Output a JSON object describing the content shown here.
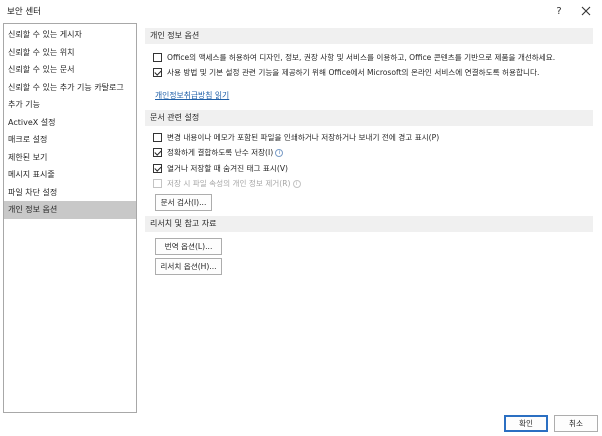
{
  "window": {
    "title": "보안 센터",
    "help": "?",
    "close": "✕"
  },
  "sidebar": {
    "items": [
      {
        "label": "신뢰할 수 있는 게시자"
      },
      {
        "label": "신뢰할 수 있는 위치"
      },
      {
        "label": "신뢰할 수 있는 문서"
      },
      {
        "label": "신뢰할 수 있는 추가 기능 카탈로그"
      },
      {
        "label": "추가 기능"
      },
      {
        "label": "ActiveX 설정"
      },
      {
        "label": "매크로 설정"
      },
      {
        "label": "제한된 보기"
      },
      {
        "label": "메시지 표시줄"
      },
      {
        "label": "파일 차단 설정"
      },
      {
        "label": "개인 정보 옵션"
      }
    ]
  },
  "privacy": {
    "header": "개인 정보 옵션",
    "opt1": {
      "label": "Office의 액세스를 허용하여 디자인, 정보, 권장 사항 및 서비스를 이용하고, Office 콘텐츠를 기반으로 제품을 개선하세요.",
      "checked": false
    },
    "opt2": {
      "label": "사용 방법 및 기본 설정 관련 기능을 제공하기 위해 Office에서 Microsoft의 온라인 서비스에 연결하도록 허용합니다.",
      "checked": true
    },
    "link": "개인정보취급방침 읽기"
  },
  "document": {
    "header": "문서 관련 설정",
    "opt1": {
      "label": "변경 내용이나 메모가 포함된 파일을 인쇄하거나 저장하거나 보내기 전에 경고 표시(P)",
      "checked": false
    },
    "opt2": {
      "label": "정확하게 결합하도록 난수 저장(I)",
      "checked": true
    },
    "opt3": {
      "label": "열거나 저장할 때 숨겨진 태그 표시(V)",
      "checked": true
    },
    "opt4": {
      "label": "저장 시 파일 속성의 개인 정보 제거(R)",
      "checked": false
    },
    "inspect_button": "문서 검사(I)..."
  },
  "research": {
    "header": "리서치 및 참고 자료",
    "translate_button": "번역 옵션(L)...",
    "research_button": "리서치 옵션(H)..."
  },
  "footer": {
    "ok": "확인",
    "cancel": "취소"
  },
  "icons": {
    "info": "i"
  }
}
